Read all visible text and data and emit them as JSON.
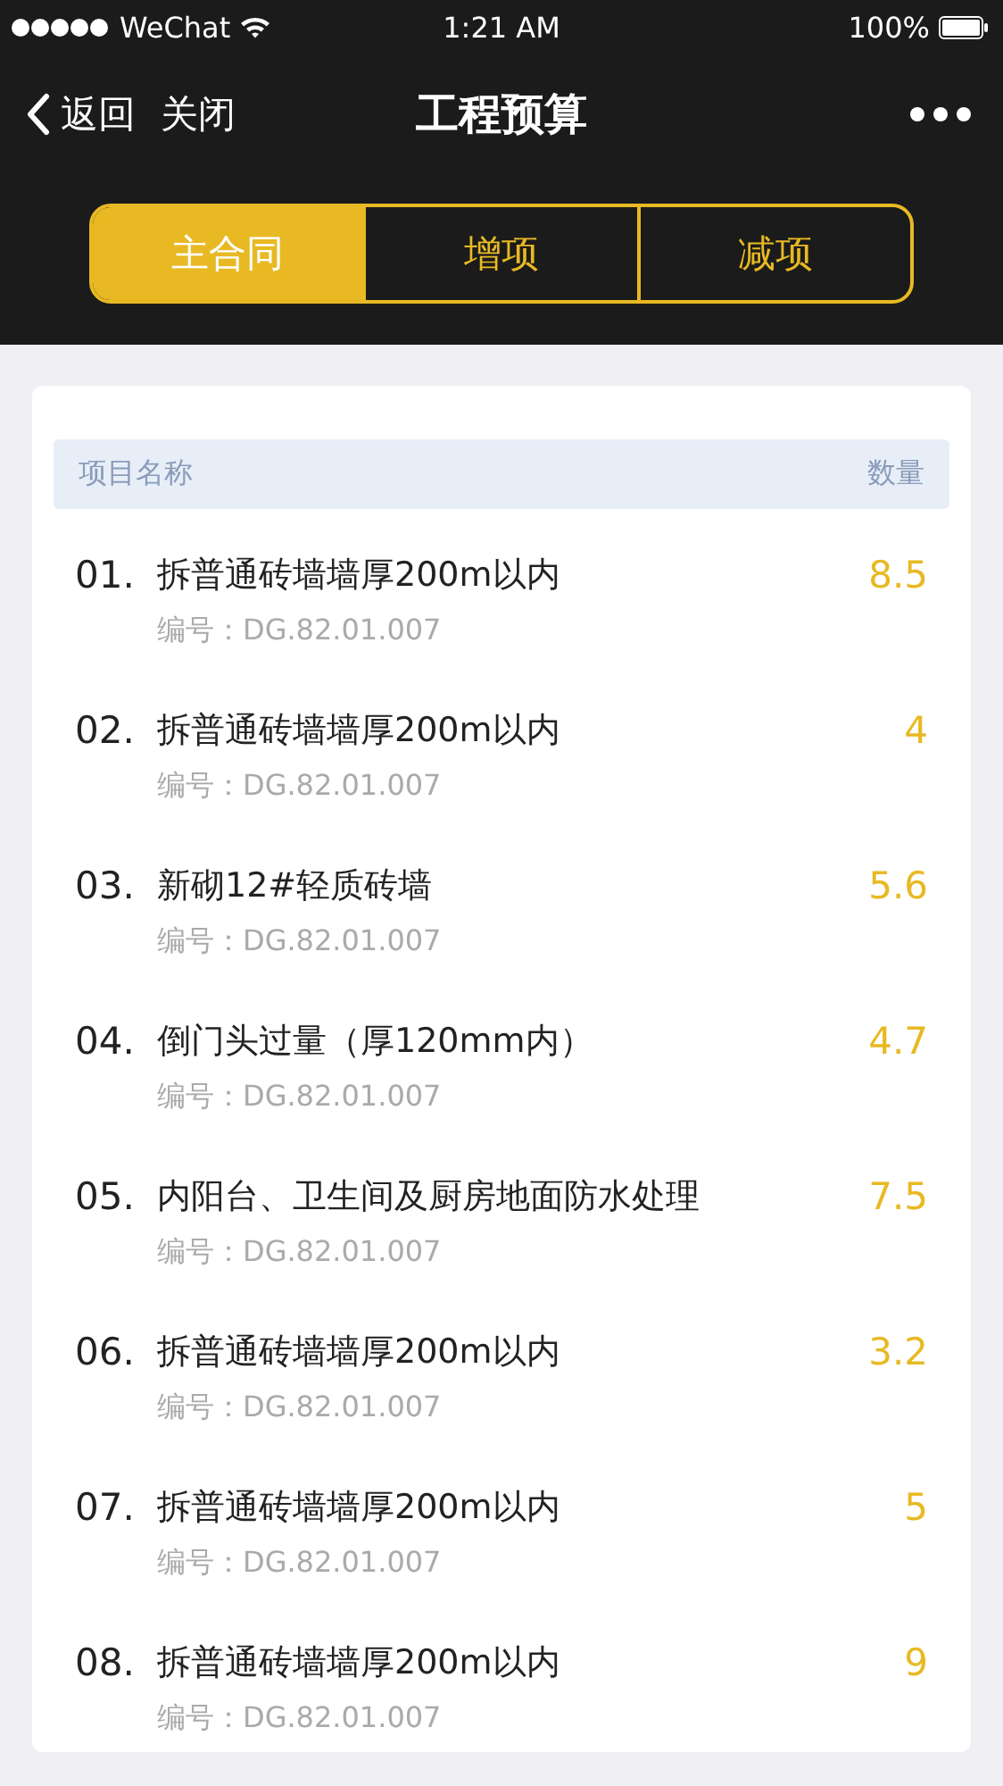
{
  "status_bar": {
    "carrier": "WeChat",
    "time": "1:21 AM",
    "battery": "100%"
  },
  "nav": {
    "back": "返回",
    "close": "关闭",
    "title": "工程预算"
  },
  "tabs": [
    {
      "label": "主合同",
      "selected": true
    },
    {
      "label": "增项",
      "selected": false
    },
    {
      "label": "减项",
      "selected": false
    }
  ],
  "table": {
    "columns": [
      "项目名称",
      "数量"
    ],
    "rows": [
      {
        "index": "01.",
        "name": "拆普通砖墙墙厚200m以内",
        "code": "编号：DG.82.01.007",
        "quantity": "8.5"
      },
      {
        "index": "02.",
        "name": "拆普通砖墙墙厚200m以内",
        "code": "编号：DG.82.01.007",
        "quantity": "4"
      },
      {
        "index": "03.",
        "name": "新砌12#轻质砖墙",
        "code": "编号：DG.82.01.007",
        "quantity": "5.6"
      },
      {
        "index": "04.",
        "name": "倒门头过量（厚120mm内）",
        "code": "编号：DG.82.01.007",
        "quantity": "4.7"
      },
      {
        "index": "05.",
        "name": "内阳台、卫生间及厨房地面防水处理",
        "code": "编号：DG.82.01.007",
        "quantity": "7.5"
      },
      {
        "index": "06.",
        "name": "拆普通砖墙墙厚200m以内",
        "code": "编号：DG.82.01.007",
        "quantity": "3.2"
      },
      {
        "index": "07.",
        "name": "拆普通砖墙墙厚200m以内",
        "code": "编号：DG.82.01.007",
        "quantity": "5"
      },
      {
        "index": "08.",
        "name": "拆普通砖墙墙厚200m以内",
        "code": "编号：DG.82.01.007",
        "quantity": "9"
      }
    ]
  }
}
